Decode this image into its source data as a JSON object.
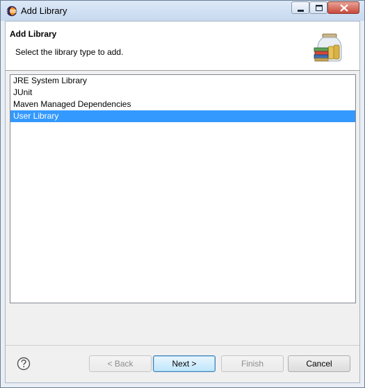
{
  "window": {
    "title": "Add Library"
  },
  "header": {
    "title": "Add Library",
    "description": "Select the library type to add."
  },
  "library_types": [
    {
      "label": "JRE System Library",
      "selected": false
    },
    {
      "label": "JUnit",
      "selected": false
    },
    {
      "label": "Maven Managed Dependencies",
      "selected": false
    },
    {
      "label": "User Library",
      "selected": true
    }
  ],
  "buttons": {
    "back": "< Back",
    "next": "Next >",
    "finish": "Finish",
    "cancel": "Cancel"
  },
  "colors": {
    "selection": "#3399ff",
    "title_bar": "#c8d9ef",
    "dialog_bg": "#f0f0f0"
  }
}
